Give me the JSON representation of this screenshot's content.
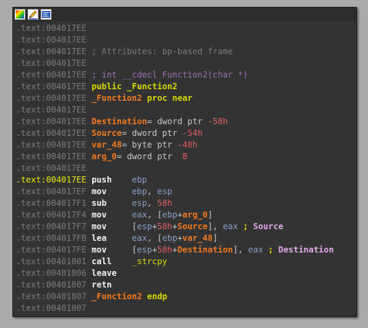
{
  "toolbar": {
    "buttons": [
      {
        "name": "graph-colors-icon"
      },
      {
        "name": "edit-pencil-icon"
      },
      {
        "name": "disasm-view-icon"
      }
    ]
  },
  "lines": [
    {
      "addr": ".text:004017EE",
      "tokens": []
    },
    {
      "addr": ".text:004017EE",
      "tokens": []
    },
    {
      "addr": ".text:004017EE",
      "tokens": [
        {
          "t": " ; Attributes: bp-based frame",
          "c": "comment"
        }
      ]
    },
    {
      "addr": ".text:004017EE",
      "tokens": []
    },
    {
      "addr": ".text:004017EE",
      "tokens": [
        {
          "t": " ; int __cdecl Function2(char *)",
          "c": "proto"
        }
      ]
    },
    {
      "addr": ".text:004017EE",
      "tokens": [
        {
          "t": " public _Function2",
          "c": "kw"
        }
      ]
    },
    {
      "addr": ".text:004017EE",
      "tokens": [
        {
          "t": " _Function2",
          "c": "fn"
        },
        {
          "t": " proc near",
          "c": "kw"
        }
      ]
    },
    {
      "addr": ".text:004017EE",
      "tokens": []
    },
    {
      "addr": ".text:004017EE",
      "tokens": [
        {
          "t": " Destination",
          "c": "var"
        },
        {
          "t": "= dword ptr ",
          "c": "plain"
        },
        {
          "t": "-58h",
          "c": "num"
        }
      ]
    },
    {
      "addr": ".text:004017EE",
      "tokens": [
        {
          "t": " Source",
          "c": "var"
        },
        {
          "t": "= dword ptr ",
          "c": "plain"
        },
        {
          "t": "-54h",
          "c": "num"
        }
      ]
    },
    {
      "addr": ".text:004017EE",
      "tokens": [
        {
          "t": " var_48",
          "c": "var"
        },
        {
          "t": "= byte ptr ",
          "c": "plain"
        },
        {
          "t": "-48h",
          "c": "num"
        }
      ]
    },
    {
      "addr": ".text:004017EE",
      "tokens": [
        {
          "t": " arg_0",
          "c": "var"
        },
        {
          "t": "= dword ptr  ",
          "c": "plain"
        },
        {
          "t": "8",
          "c": "num"
        }
      ]
    },
    {
      "addr": ".text:004017EE",
      "tokens": []
    },
    {
      "addr": ".text:004017EE",
      "cur": true,
      "tokens": [
        {
          "t": " push    ",
          "c": "mnem"
        },
        {
          "t": "ebp",
          "c": "reg"
        }
      ]
    },
    {
      "addr": ".text:004017EF",
      "tokens": [
        {
          "t": " mov     ",
          "c": "mnem"
        },
        {
          "t": "ebp",
          "c": "reg"
        },
        {
          "t": ", ",
          "c": "punct"
        },
        {
          "t": "esp",
          "c": "reg"
        }
      ]
    },
    {
      "addr": ".text:004017F1",
      "tokens": [
        {
          "t": " sub     ",
          "c": "mnem"
        },
        {
          "t": "esp",
          "c": "reg"
        },
        {
          "t": ", ",
          "c": "punct"
        },
        {
          "t": "58h",
          "c": "num"
        }
      ]
    },
    {
      "addr": ".text:004017F4",
      "tokens": [
        {
          "t": " mov     ",
          "c": "mnem"
        },
        {
          "t": "eax",
          "c": "reg"
        },
        {
          "t": ", [",
          "c": "punct"
        },
        {
          "t": "ebp",
          "c": "reg"
        },
        {
          "t": "+",
          "c": "punct"
        },
        {
          "t": "arg_0",
          "c": "var"
        },
        {
          "t": "]",
          "c": "punct"
        }
      ]
    },
    {
      "addr": ".text:004017F7",
      "tokens": [
        {
          "t": " mov     ",
          "c": "mnem"
        },
        {
          "t": "[",
          "c": "punct"
        },
        {
          "t": "esp",
          "c": "reg"
        },
        {
          "t": "+",
          "c": "punct"
        },
        {
          "t": "58h",
          "c": "num"
        },
        {
          "t": "+",
          "c": "punct"
        },
        {
          "t": "Source",
          "c": "var"
        },
        {
          "t": "], ",
          "c": "punct"
        },
        {
          "t": "eax",
          "c": "reg"
        },
        {
          "t": " ; ",
          "c": "sc"
        },
        {
          "t": "Source",
          "c": "cref"
        }
      ]
    },
    {
      "addr": ".text:004017FB",
      "tokens": [
        {
          "t": " lea     ",
          "c": "mnem"
        },
        {
          "t": "eax",
          "c": "reg"
        },
        {
          "t": ", [",
          "c": "punct"
        },
        {
          "t": "ebp",
          "c": "reg"
        },
        {
          "t": "+",
          "c": "punct"
        },
        {
          "t": "var_48",
          "c": "var"
        },
        {
          "t": "]",
          "c": "punct"
        }
      ]
    },
    {
      "addr": ".text:004017FE",
      "tokens": [
        {
          "t": " mov     ",
          "c": "mnem"
        },
        {
          "t": "[",
          "c": "punct"
        },
        {
          "t": "esp",
          "c": "reg"
        },
        {
          "t": "+",
          "c": "punct"
        },
        {
          "t": "58h",
          "c": "num"
        },
        {
          "t": "+",
          "c": "punct"
        },
        {
          "t": "Destination",
          "c": "var"
        },
        {
          "t": "], ",
          "c": "punct"
        },
        {
          "t": "eax",
          "c": "reg"
        },
        {
          "t": " ; ",
          "c": "sc"
        },
        {
          "t": "Destination",
          "c": "cref"
        }
      ]
    },
    {
      "addr": ".text:00401801",
      "tokens": [
        {
          "t": " call    ",
          "c": "mnem"
        },
        {
          "t": "_strcpy",
          "c": "sym"
        }
      ]
    },
    {
      "addr": ".text:00401806",
      "tokens": [
        {
          "t": " leave",
          "c": "mnem"
        }
      ]
    },
    {
      "addr": ".text:00401807",
      "tokens": [
        {
          "t": " retn",
          "c": "mnem"
        }
      ]
    },
    {
      "addr": ".text:00401807",
      "tokens": [
        {
          "t": " _Function2",
          "c": "fn"
        },
        {
          "t": " endp",
          "c": "kw"
        }
      ]
    },
    {
      "addr": ".text:00401807",
      "tokens": []
    }
  ]
}
